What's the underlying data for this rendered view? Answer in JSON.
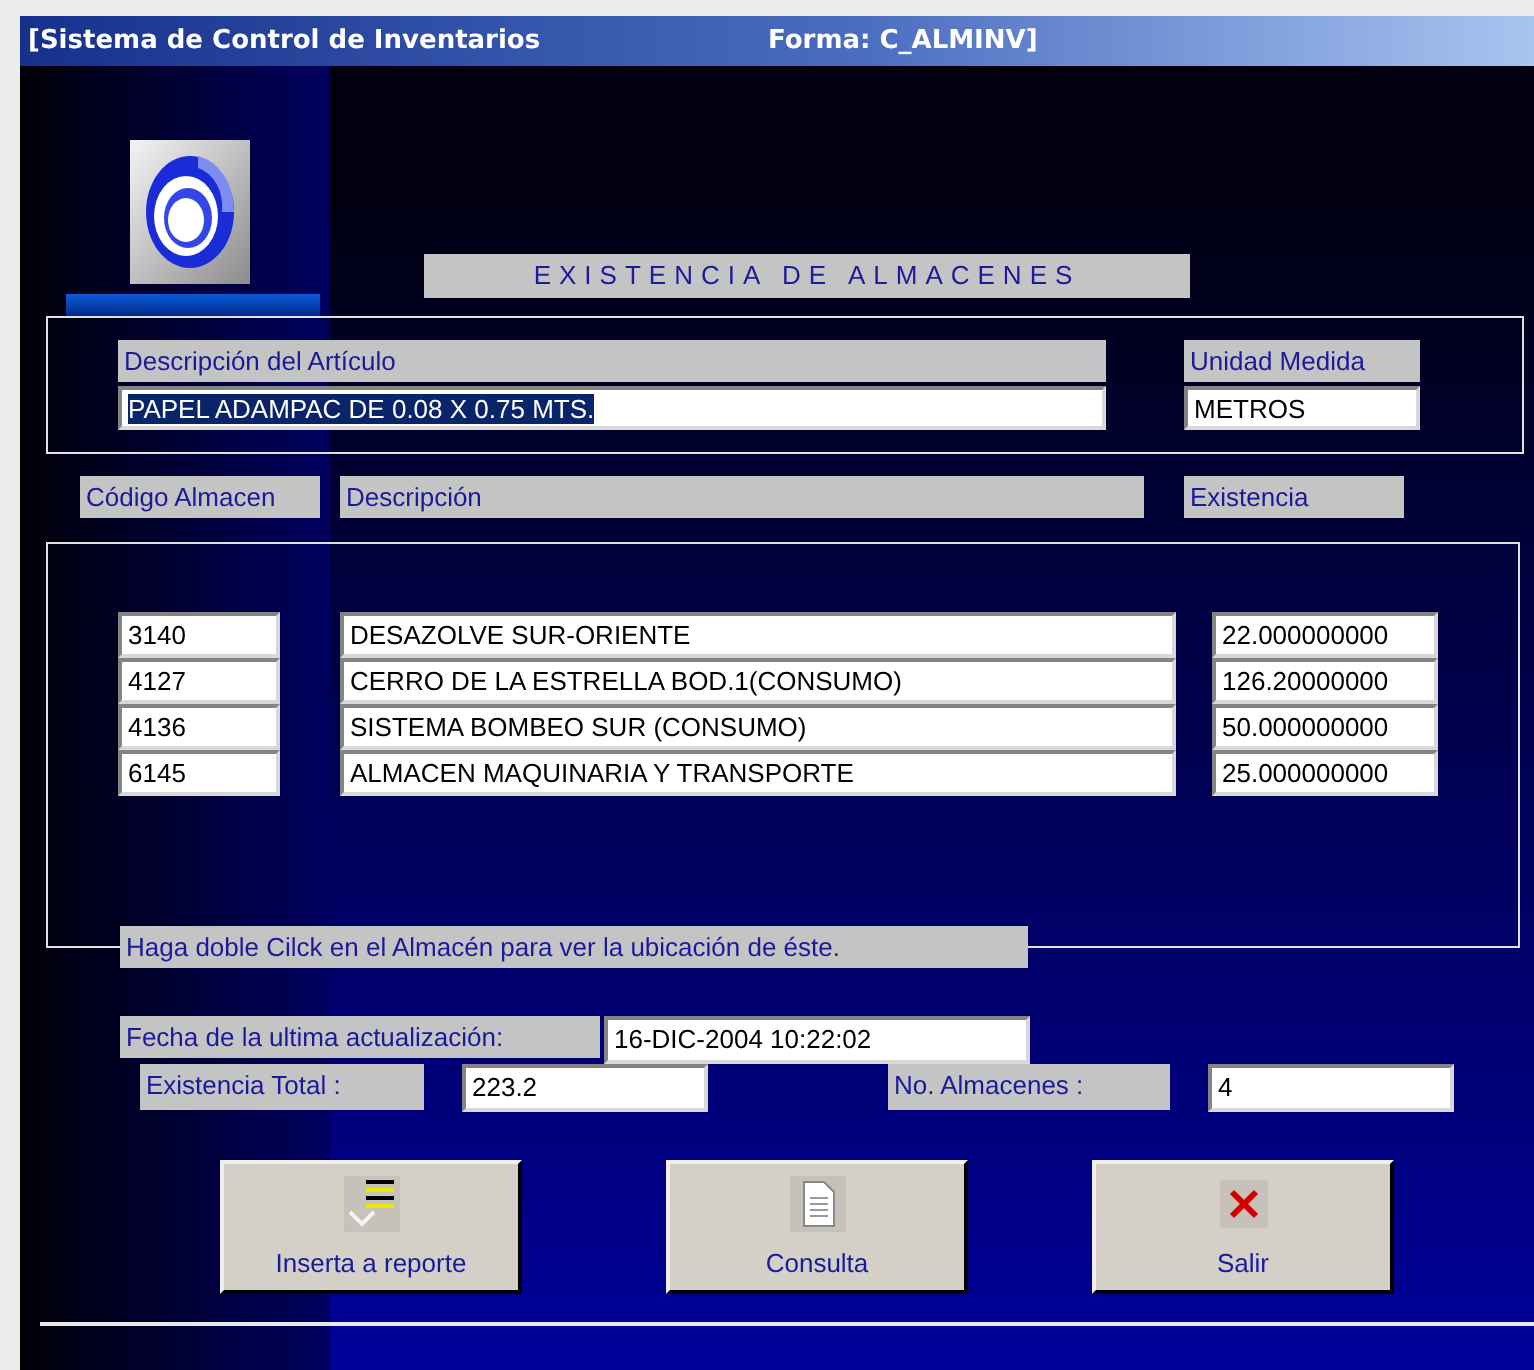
{
  "window": {
    "title": "[Sistema de Control de Inventarios",
    "form": "Forma: C_ALMINV]"
  },
  "heading": "EXISTENCIA DE ALMACENES",
  "article": {
    "description_label": "Descripción del Artículo",
    "description": "PAPEL ADAMPAC DE 0.08 X 0.75 MTS.",
    "description_selected": true,
    "unit_label": "Unidad Medida",
    "unit": "METROS"
  },
  "table": {
    "columns": [
      "Código Almacen",
      "Descripción",
      "Existencia"
    ],
    "rows": [
      {
        "code": "3140",
        "description": "DESAZOLVE SUR-ORIENTE",
        "stock": "22.000000000"
      },
      {
        "code": "4127",
        "description": "CERRO DE LA ESTRELLA BOD.1(CONSUMO)",
        "stock": "126.20000000"
      },
      {
        "code": "4136",
        "description": "SISTEMA BOMBEO SUR (CONSUMO)",
        "stock": "50.000000000"
      },
      {
        "code": "6145",
        "description": "ALMACEN MAQUINARIA Y TRANSPORTE",
        "stock": "25.000000000"
      }
    ]
  },
  "hint": "Haga doble Cilck en el Almacén para ver la ubicación de éste.",
  "summary": {
    "updated_label": "Fecha de la ultima actualización:",
    "updated": "16-DIC-2004 10:22:02",
    "total_label": "Existencia Total :",
    "total": "223.2",
    "count_label": "No. Almacenes :",
    "count": "4"
  },
  "buttons": [
    {
      "kind": "report",
      "label": "Inserta a reporte"
    },
    {
      "kind": "query",
      "label": "Consulta"
    },
    {
      "kind": "exit",
      "label": "Salir"
    }
  ]
}
